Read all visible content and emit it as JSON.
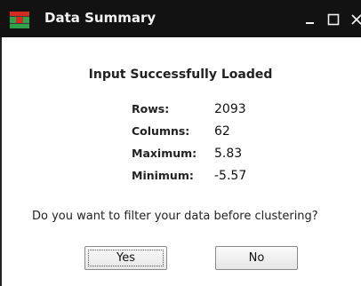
{
  "window": {
    "title": "Data Summary",
    "app_icon": "heatmap-icon",
    "controls": {
      "minimize_icon": "minimize-icon",
      "maximize_icon": "maximize-icon",
      "close_icon": "close-icon"
    }
  },
  "dialog": {
    "heading": "Input Successfully Loaded",
    "stats": [
      {
        "label": "Rows:",
        "value": "2093"
      },
      {
        "label": "Columns:",
        "value": "62"
      },
      {
        "label": "Maximum:",
        "value": "5.83"
      },
      {
        "label": "Minimum:",
        "value": "-5.57"
      }
    ],
    "question": "Do you want to filter your data before clustering?",
    "buttons": {
      "yes": "Yes",
      "no": "No"
    }
  },
  "colors": {
    "titlebar": "#121212",
    "icon_red": "#d42a1f",
    "icon_green": "#2fa34a"
  }
}
